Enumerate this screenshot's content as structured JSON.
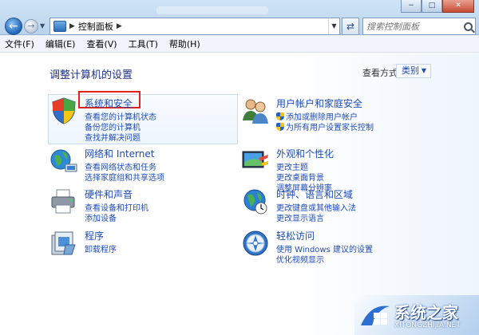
{
  "address": {
    "path": "控制面板",
    "search_placeholder": "搜索控制面板"
  },
  "window_controls": {
    "minimize": "−",
    "maximize": "□",
    "close": "✕"
  },
  "menu": [
    "文件(F)",
    "编辑(E)",
    "查看(V)",
    "工具(T)",
    "帮助(H)"
  ],
  "page_title": "调整计算机的设置",
  "view_by": {
    "label": "查看方式:",
    "value": "类别"
  },
  "categories": [
    {
      "title": "系统和安全",
      "links": [
        "查看您的计算机状态",
        "备份您的计算机",
        "查找并解决问题"
      ],
      "icon": "system-security-icon"
    },
    {
      "title": "网络和 Internet",
      "links": [
        "查看网络状态和任务",
        "选择家庭组和共享选项"
      ],
      "icon": "network-icon"
    },
    {
      "title": "硬件和声音",
      "links": [
        "查看设备和打印机",
        "添加设备"
      ],
      "icon": "printer-icon"
    },
    {
      "title": "程序",
      "links": [
        "卸载程序"
      ],
      "icon": "programs-icon"
    },
    {
      "title": "用户帐户和家庭安全",
      "links": [
        "添加或删除用户帐户",
        "为所有用户设置家长控制"
      ],
      "icon": "users-icon"
    },
    {
      "title": "外观和个性化",
      "links": [
        "更改主题",
        "更改桌面背景",
        "调整屏幕分辨率"
      ],
      "icon": "appearance-icon"
    },
    {
      "title": "时钟、语言和区域",
      "links": [
        "更改键盘或其他输入法",
        "更改显示语言"
      ],
      "icon": "clock-globe-icon"
    },
    {
      "title": "轻松访问",
      "links": [
        "使用 Windows 建议的设置",
        "优化视频显示"
      ],
      "icon": "ease-of-access-icon"
    }
  ],
  "watermark": {
    "text": "系统之家",
    "url": "XITONGZHIJIA.NET"
  },
  "colors": {
    "link": "#1e4bb4",
    "title": "#1e3287",
    "highlight": "#e0241c"
  }
}
